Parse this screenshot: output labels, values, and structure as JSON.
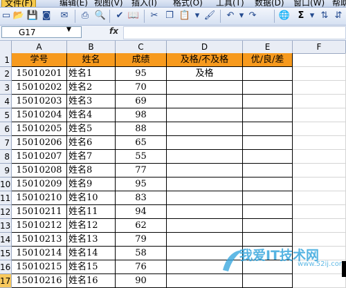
{
  "menubar": {
    "items": [
      "文件(F)",
      "编辑(E)",
      "视图(V)",
      "插入(I)",
      "格式(O)",
      "工具(T)",
      "数据(D)",
      "窗口(W)",
      "帮助"
    ]
  },
  "toolbar": {
    "icons": [
      "new-icon",
      "open-icon",
      "save-icon",
      "permission-icon",
      "print-icon",
      "print-preview-icon",
      "spelling-icon",
      "cut-icon",
      "copy-icon",
      "paste-icon",
      "format-painter-icon",
      "undo-icon",
      "redo-icon",
      "hyperlink-icon",
      "autosum-icon",
      "sort-icon"
    ],
    "sigma": "Σ"
  },
  "formula_bar": {
    "name_box": "G17",
    "fx": "fx",
    "value": ""
  },
  "columns": [
    "A",
    "B",
    "C",
    "D",
    "E",
    "F"
  ],
  "sheet": {
    "headers": [
      "学号",
      "姓名",
      "成绩",
      "及格/不及格",
      "优/良/差"
    ],
    "rows": [
      {
        "n": "2",
        "id": "15010201",
        "name": "姓名1",
        "score": "95",
        "pass": "及格",
        "grade": ""
      },
      {
        "n": "3",
        "id": "15010202",
        "name": "姓名2",
        "score": "70",
        "pass": "",
        "grade": ""
      },
      {
        "n": "4",
        "id": "15010203",
        "name": "姓名3",
        "score": "69",
        "pass": "",
        "grade": ""
      },
      {
        "n": "5",
        "id": "15010204",
        "name": "姓名4",
        "score": "98",
        "pass": "",
        "grade": ""
      },
      {
        "n": "6",
        "id": "15010205",
        "name": "姓名5",
        "score": "88",
        "pass": "",
        "grade": ""
      },
      {
        "n": "7",
        "id": "15010206",
        "name": "姓名6",
        "score": "65",
        "pass": "",
        "grade": ""
      },
      {
        "n": "8",
        "id": "15010207",
        "name": "姓名7",
        "score": "55",
        "pass": "",
        "grade": ""
      },
      {
        "n": "9",
        "id": "15010208",
        "name": "姓名8",
        "score": "77",
        "pass": "",
        "grade": ""
      },
      {
        "n": "10",
        "id": "15010209",
        "name": "姓名9",
        "score": "95",
        "pass": "",
        "grade": ""
      },
      {
        "n": "11",
        "id": "15010210",
        "name": "姓名10",
        "score": "83",
        "pass": "",
        "grade": ""
      },
      {
        "n": "12",
        "id": "15010211",
        "name": "姓名11",
        "score": "94",
        "pass": "",
        "grade": ""
      },
      {
        "n": "13",
        "id": "15010212",
        "name": "姓名12",
        "score": "62",
        "pass": "",
        "grade": ""
      },
      {
        "n": "14",
        "id": "15010213",
        "name": "姓名13",
        "score": "79",
        "pass": "",
        "grade": ""
      },
      {
        "n": "15",
        "id": "15010214",
        "name": "姓名14",
        "score": "58",
        "pass": "",
        "grade": ""
      },
      {
        "n": "16",
        "id": "15010215",
        "name": "姓名15",
        "score": "76",
        "pass": "",
        "grade": ""
      },
      {
        "n": "17",
        "id": "15010216",
        "name": "姓名16",
        "score": "90",
        "pass": "",
        "grade": ""
      }
    ]
  },
  "watermark": {
    "text": "我爱IT技术网",
    "url": "www.52ij.com"
  },
  "colors": {
    "header_fill": "#f79a1e",
    "selected_row_header": "#f8c85c",
    "watermark": "#39a7de"
  }
}
